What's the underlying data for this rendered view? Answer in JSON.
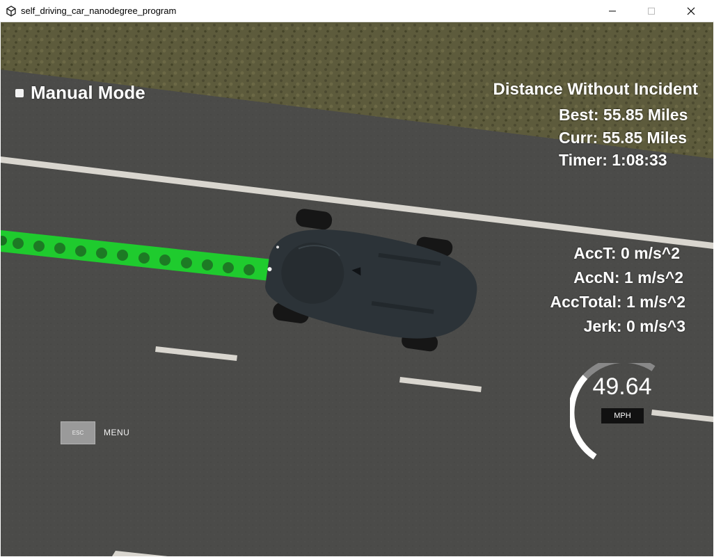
{
  "window": {
    "title": "self_driving_car_nanodegree_program",
    "icons": {
      "app": "unity-icon",
      "minimize": "minimize-icon",
      "maximize": "maximize-icon",
      "close": "close-icon"
    }
  },
  "hud": {
    "mode_label": "Manual Mode",
    "distance_title": "Distance Without Incident",
    "best": "Best: 55.85 Miles",
    "curr": "Curr: 55.85 Miles",
    "timer": "Timer: 1:08:33",
    "acc_t": "AccT: 0 m/s^2",
    "acc_n": "AccN: 1 m/s^2",
    "acc_total": "AccTotal: 1 m/s^2",
    "jerk": "Jerk: 0 m/s^3"
  },
  "speedometer": {
    "value": "49.64",
    "unit": "MPH",
    "fill_fraction": 0.55
  },
  "menu": {
    "esc_label": "ESC",
    "menu_label": "MENU"
  },
  "colors": {
    "road": "#4a4a48",
    "grass": "#5c5a3a",
    "path": "#22cc33",
    "path_dot": "#1a7a22",
    "car": "#2c3236",
    "hud_text": "#ffffff",
    "gauge_track": "#888888",
    "gauge_fill": "#ffffff"
  }
}
